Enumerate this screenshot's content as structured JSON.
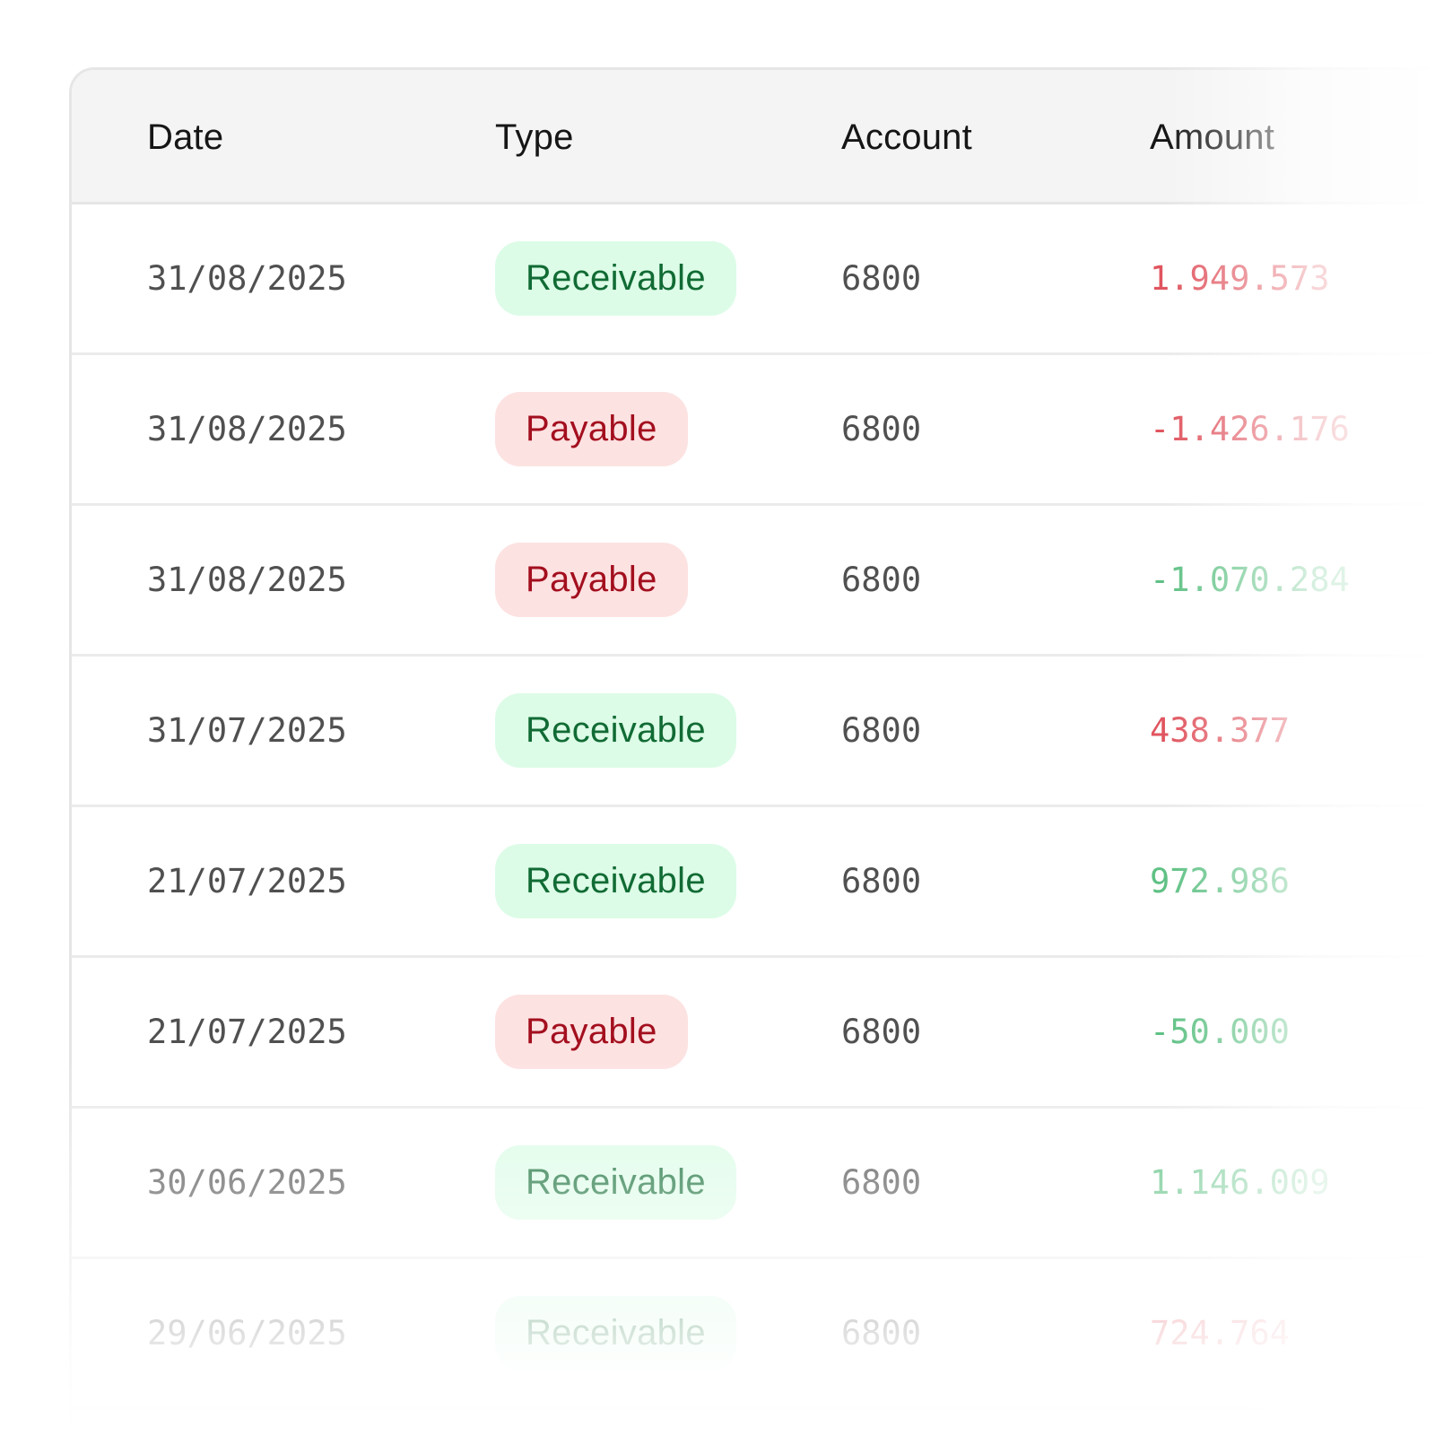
{
  "table": {
    "columns": {
      "date": "Date",
      "type": "Type",
      "account": "Account",
      "amount": "Amount"
    },
    "rows": [
      {
        "date": "31/08/2025",
        "type": "Receivable",
        "account": "6800",
        "amount": "1.949.573"
      },
      {
        "date": "31/08/2025",
        "type": "Payable",
        "account": "6800",
        "amount": "-1.426.176"
      },
      {
        "date": "31/08/2025",
        "type": "Payable",
        "account": "6800",
        "amount": "-1.070.284"
      },
      {
        "date": "31/07/2025",
        "type": "Receivable",
        "account": "6800",
        "amount": "438.377"
      },
      {
        "date": "21/07/2025",
        "type": "Receivable",
        "account": "6800",
        "amount": "972.986"
      },
      {
        "date": "21/07/2025",
        "type": "Payable",
        "account": "6800",
        "amount": "-50.000"
      },
      {
        "date": "30/06/2025",
        "type": "Receivable",
        "account": "6800",
        "amount": "1.146.009"
      },
      {
        "date": "29/06/2025",
        "type": "Receivable",
        "account": "6800",
        "amount": "724.764"
      }
    ]
  },
  "colors": {
    "receivable_bg": "#dcfce7",
    "receivable_text": "#116b34",
    "payable_bg": "#fde2e2",
    "payable_text": "#a30f1e",
    "amount_red": "#e0555f",
    "amount_green": "#5fc184",
    "header_bg": "#f4f4f4"
  }
}
